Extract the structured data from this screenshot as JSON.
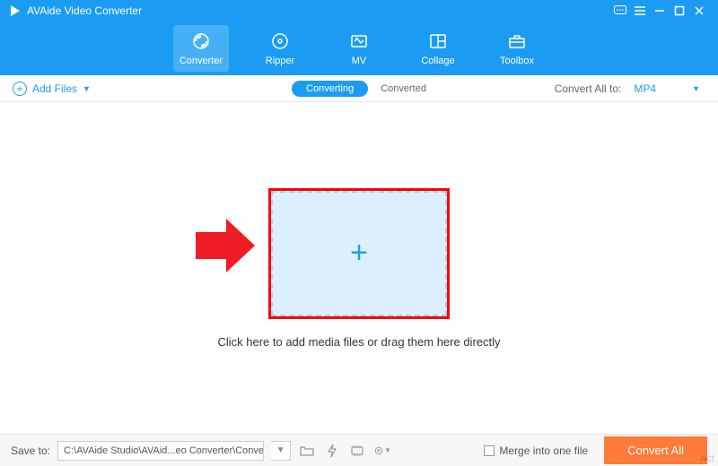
{
  "app": {
    "title": "AVAide Video Converter"
  },
  "nav": {
    "items": [
      {
        "label": "Converter"
      },
      {
        "label": "Ripper"
      },
      {
        "label": "MV"
      },
      {
        "label": "Collage"
      },
      {
        "label": "Toolbox"
      }
    ]
  },
  "subbar": {
    "add_files": "Add Files",
    "converting_tab": "Converting",
    "converted_tab": "Converted",
    "convert_all_to": "Convert All to:",
    "format": "MP4"
  },
  "workspace": {
    "hint": "Click here to add media files or drag them here directly"
  },
  "bottombar": {
    "save_to": "Save to:",
    "path": "C:\\AVAide Studio\\AVAid...eo Converter\\Converted",
    "merge_label": "Merge into one file",
    "convert_all": "Convert All"
  },
  "watermark": "Act"
}
